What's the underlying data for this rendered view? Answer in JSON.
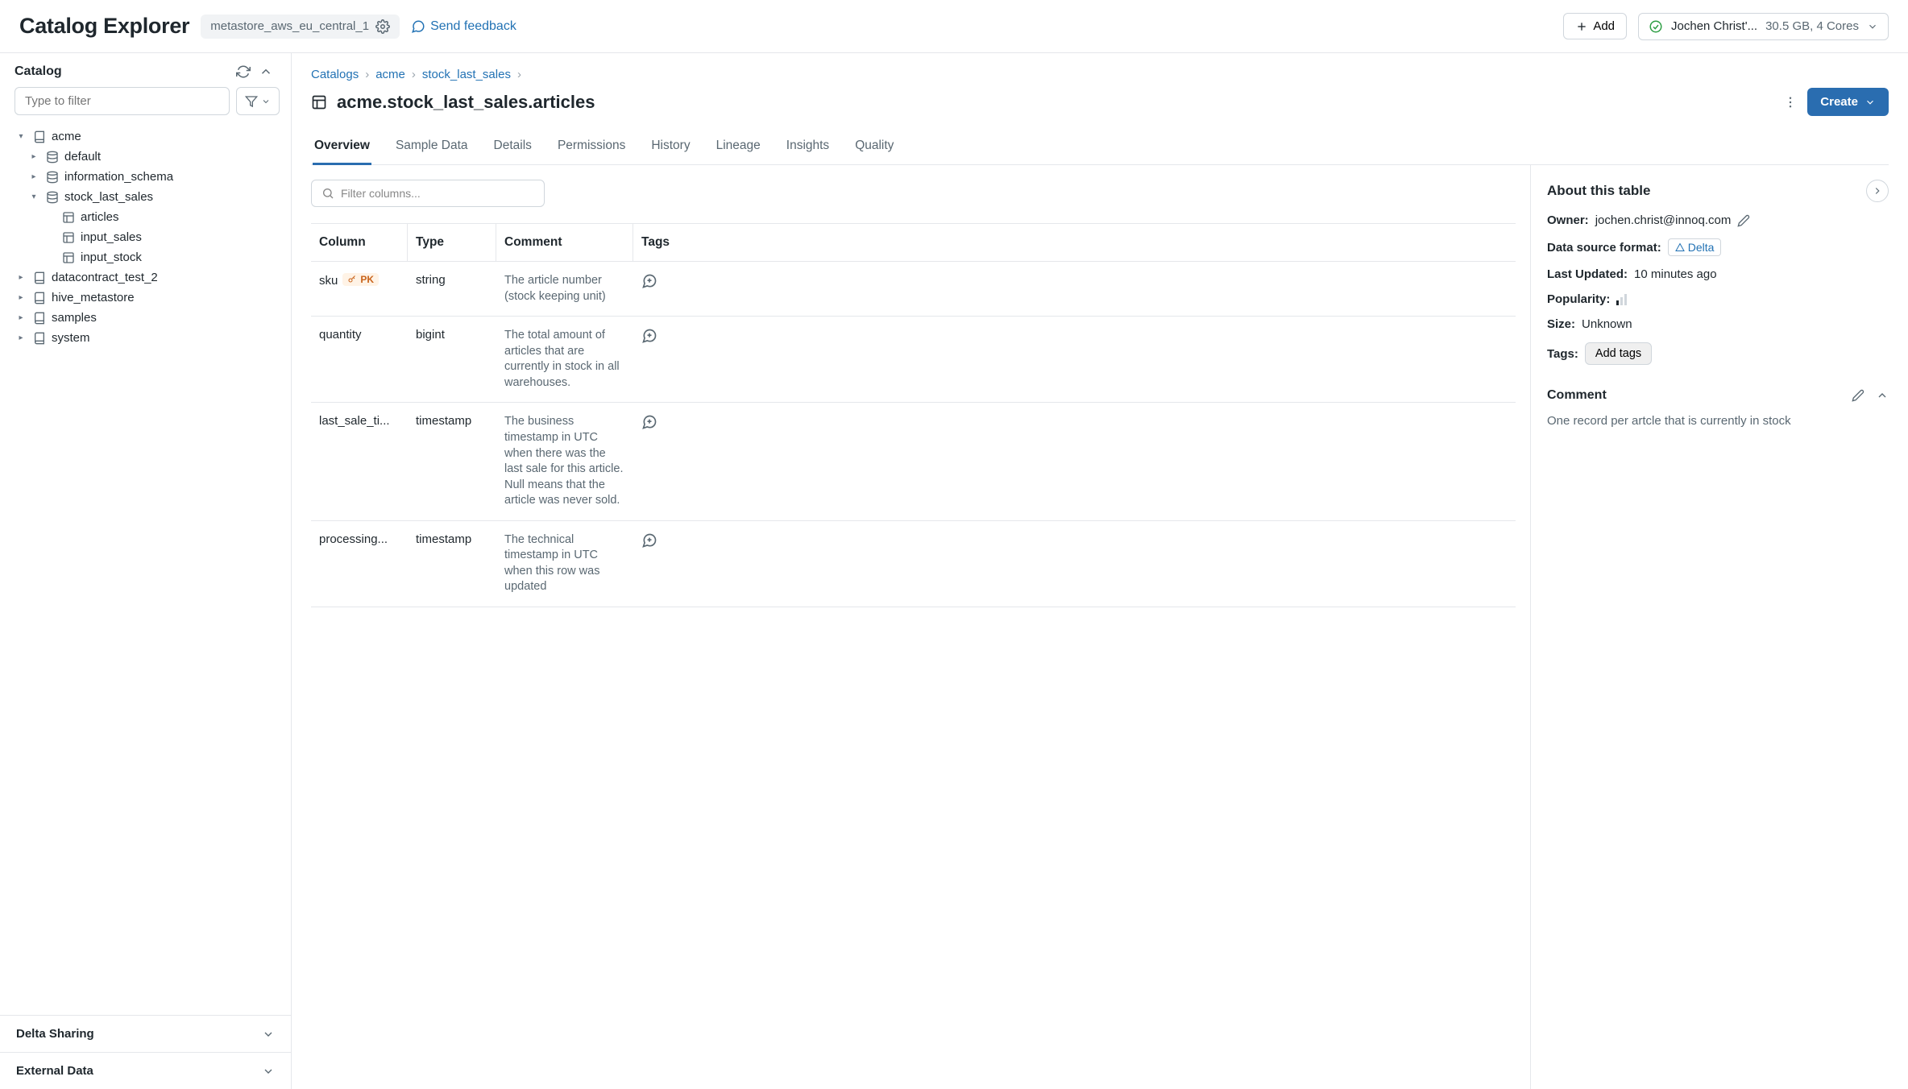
{
  "app": {
    "title": "Catalog Explorer",
    "metastore": "metastore_aws_eu_central_1",
    "feedback": "Send feedback",
    "add": "Add"
  },
  "cluster": {
    "user": "Jochen Christ'...",
    "spec": "30.5 GB, 4 Cores"
  },
  "sidebar": {
    "heading": "Catalog",
    "filter_placeholder": "Type to filter",
    "tree": {
      "acme": {
        "label": "acme",
        "default": "default",
        "info_schema": "information_schema",
        "stock": {
          "label": "stock_last_sales",
          "articles": "articles",
          "input_sales": "input_sales",
          "input_stock": "input_stock"
        }
      },
      "dc2": "datacontract_test_2",
      "hive": "hive_metastore",
      "samples": "samples",
      "system": "system"
    },
    "delta_sharing": "Delta Sharing",
    "external_data": "External Data"
  },
  "crumbs": {
    "root": "Catalogs",
    "c1": "acme",
    "c2": "stock_last_sales"
  },
  "page": {
    "title": "acme.stock_last_sales.articles",
    "create": "Create"
  },
  "tabs": [
    "Overview",
    "Sample Data",
    "Details",
    "Permissions",
    "History",
    "Lineage",
    "Insights",
    "Quality"
  ],
  "columns_filter_placeholder": "Filter columns...",
  "table": {
    "headers": {
      "col": "Column",
      "type": "Type",
      "comment": "Comment",
      "tags": "Tags"
    },
    "pk_label": "PK",
    "rows": [
      {
        "name": "sku",
        "pk": true,
        "type": "string",
        "comment": "The article number (stock keeping unit)"
      },
      {
        "name": "quantity",
        "pk": false,
        "type": "bigint",
        "comment": "The total amount of articles that are currently in stock in all warehouses."
      },
      {
        "name": "last_sale_ti...",
        "pk": false,
        "type": "timestamp",
        "comment": "The business timestamp in UTC when there was the last sale for this article. Null means that the article was never sold."
      },
      {
        "name": "processing...",
        "pk": false,
        "type": "timestamp",
        "comment": "The technical timestamp in UTC when this row was updated"
      }
    ]
  },
  "about": {
    "heading": "About this table",
    "owner_label": "Owner:",
    "owner": "jochen.christ@innoq.com",
    "format_label": "Data source format:",
    "format": "Delta",
    "updated_label": "Last Updated:",
    "updated": "10 minutes ago",
    "popularity_label": "Popularity:",
    "size_label": "Size:",
    "size": "Unknown",
    "tags_label": "Tags:",
    "add_tags": "Add tags",
    "comment_label": "Comment",
    "comment_body": "One record per artcle that is currently in stock"
  }
}
